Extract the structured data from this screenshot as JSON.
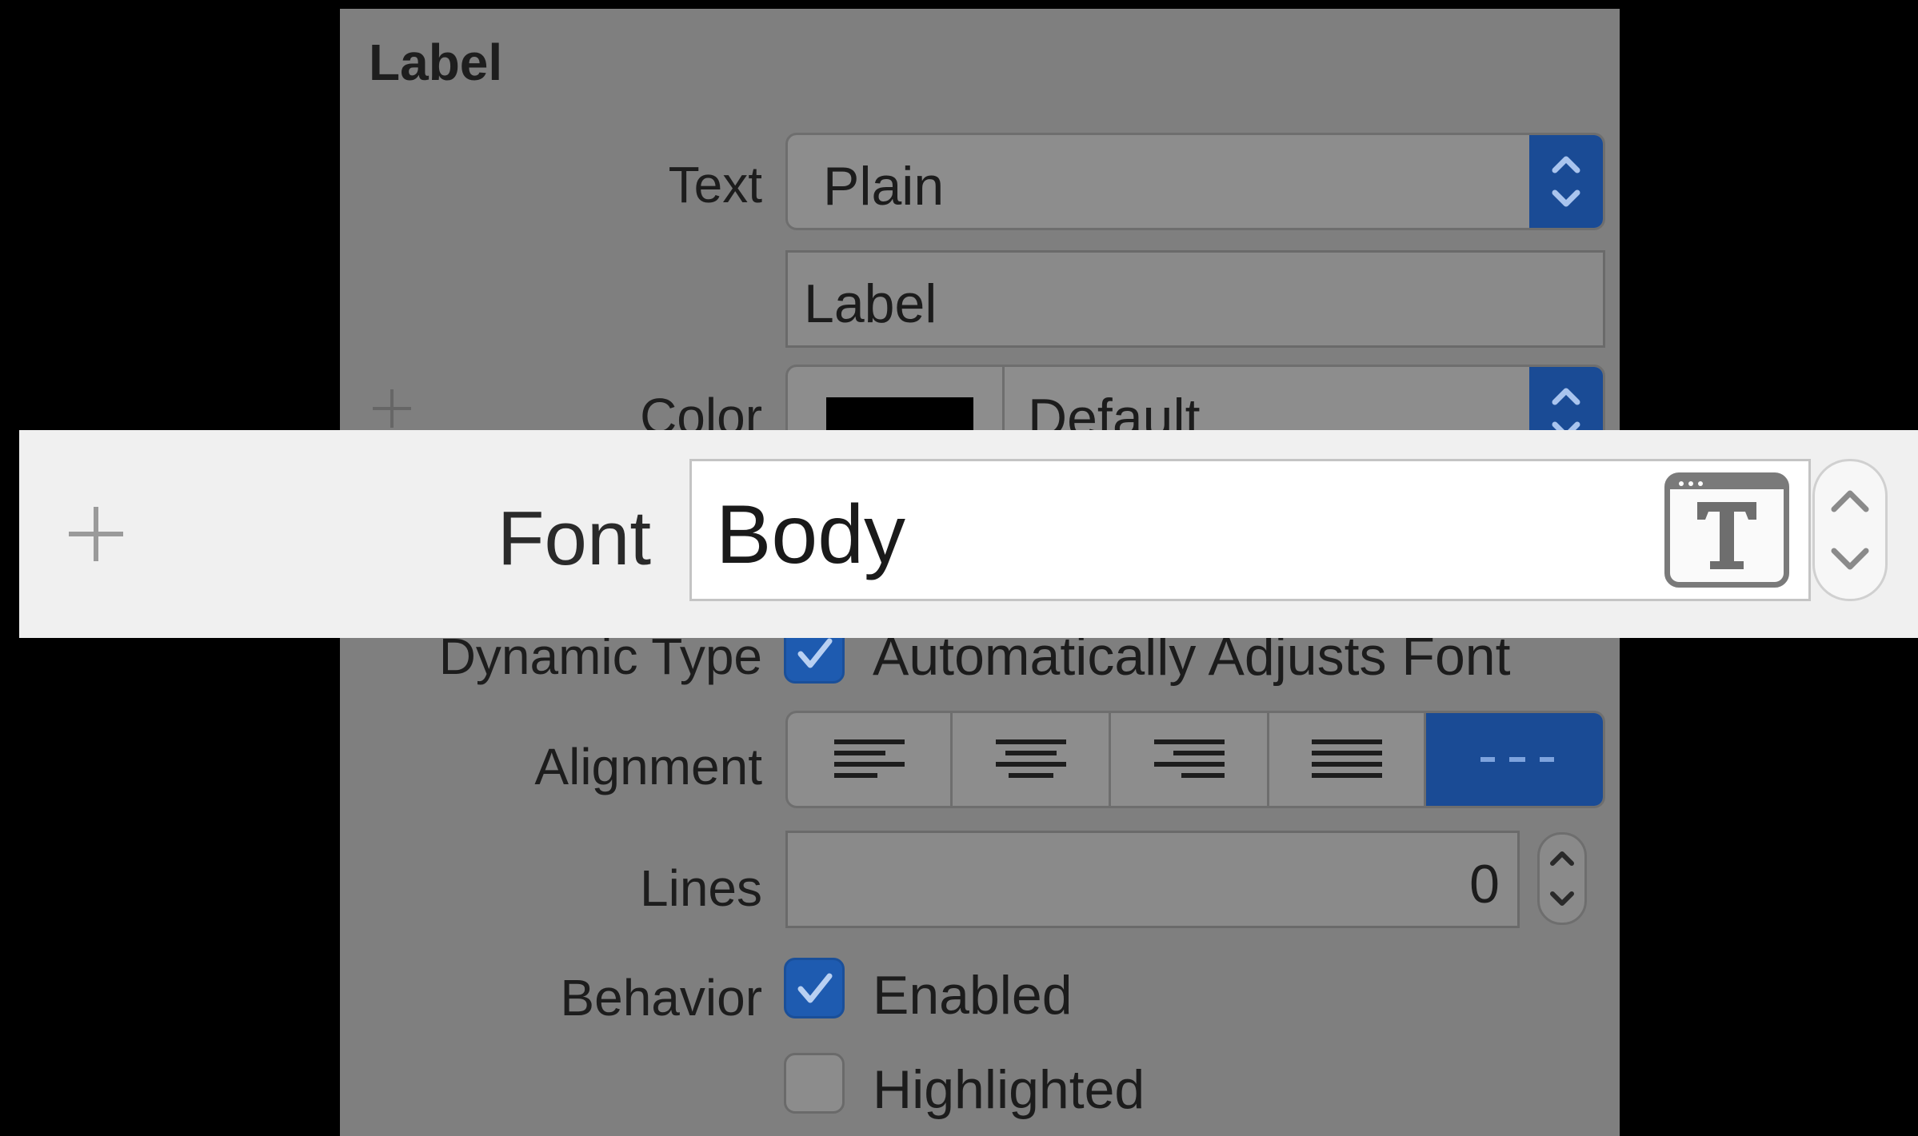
{
  "section": {
    "title": "Label"
  },
  "text_row": {
    "label": "Text",
    "value": "Plain"
  },
  "label_field": {
    "value": "Label"
  },
  "color_row": {
    "label": "Color",
    "swatch": "#000000",
    "value": "Default"
  },
  "font_row": {
    "label": "Font",
    "value": "Body"
  },
  "dynamic_type_row": {
    "label": "Dynamic Type",
    "checkbox_label": "Automatically Adjusts Font",
    "checked": true
  },
  "alignment_row": {
    "label": "Alignment",
    "options": [
      "left-align-icon",
      "center-align-icon",
      "right-align-icon",
      "justify-align-icon",
      "natural-align-icon"
    ],
    "selected": "natural-align-icon"
  },
  "lines_row": {
    "label": "Lines",
    "value": "0"
  },
  "behavior_row": {
    "label": "Behavior",
    "enabled_label": "Enabled",
    "enabled_checked": true,
    "highlighted_label": "Highlighted",
    "highlighted_checked": false
  },
  "colors": {
    "accent": "#1e5bb0",
    "background": "#000000",
    "dimmed_panel": "#7f7f7f",
    "overlay_bg": "#f0f0f0"
  }
}
